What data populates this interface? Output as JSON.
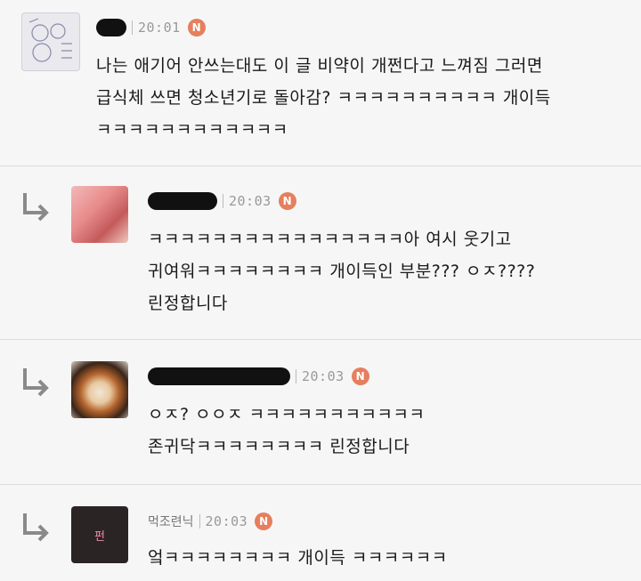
{
  "comments": [
    {
      "time": "20:01",
      "badge": "N",
      "lines": [
        "나는 애기어 안쓰는대도 이 글 비약이 개쩐다고 느껴짐 그러면",
        "급식체 쓰면 청소년기로 돌아감? ㅋㅋㅋㅋㅋㅋㅋㅋㅋㅋ 개이득",
        "ㅋㅋㅋㅋㅋㅋㅋㅋㅋㅋㅋㅋ"
      ]
    },
    {
      "time": "20:03",
      "badge": "N",
      "lines": [
        "ㅋㅋㅋㅋㅋㅋㅋㅋㅋㅋㅋㅋㅋㅋㅋㅋ아 여시 웃기고",
        "귀여워ㅋㅋㅋㅋㅋㅋㅋㅋ 개이득인 부분??? ㅇㅈ????",
        "린정합니다"
      ]
    },
    {
      "time": "20:03",
      "badge": "N",
      "lines": [
        "ㅇㅈ? ㅇㅇㅈ ㅋㅋㅋㅋㅋㅋㅋㅋㅋㅋㅋ",
        "존귀닥ㅋㅋㅋㅋㅋㅋㅋㅋ 린정합니다"
      ]
    },
    {
      "avatar_text": "펀",
      "name": "먹조련닉",
      "time": "20:03",
      "badge": "N",
      "lines": [
        "엌ㅋㅋㅋㅋㅋㅋㅋㅋ 개이득 ㅋㅋㅋㅋㅋㅋ"
      ]
    }
  ],
  "colors": {
    "badge": "#e57f5e",
    "background": "#f6f6f6",
    "divider": "#dcdcdc"
  },
  "icons": [
    "reply-arrow-icon",
    "new-badge-icon"
  ]
}
